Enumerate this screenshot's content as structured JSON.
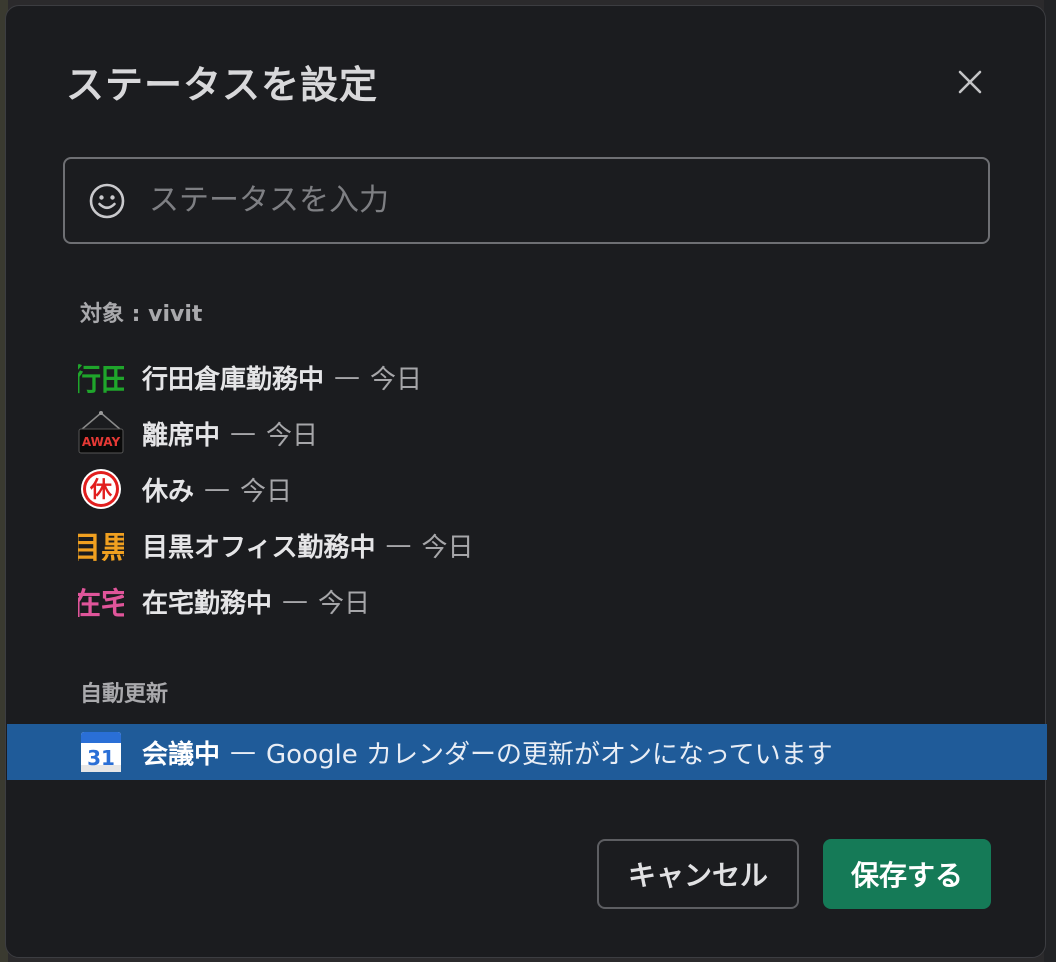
{
  "modal": {
    "title": "ステータスを設定",
    "close_icon": "close-icon"
  },
  "search": {
    "placeholder": "ステータスを入力",
    "value": "",
    "emoji_icon": "smiley-face-icon"
  },
  "recent": {
    "label": "対象 : vivit",
    "items": [
      {
        "icon": "gyoda-emoji-icon",
        "icon_text": "行田",
        "icon_color": "#1fa52b",
        "name": "行田倉庫勤務中",
        "separator": "—",
        "until": "今日"
      },
      {
        "icon": "away-sign-emoji-icon",
        "icon_text": "AWAY",
        "icon_color": "#e53935",
        "name": "離席中",
        "separator": "—",
        "until": "今日"
      },
      {
        "icon": "kyuu-rest-emoji-icon",
        "icon_text": "休",
        "icon_color": "#e21e1e",
        "name": "休み",
        "separator": "—",
        "until": "今日"
      },
      {
        "icon": "meguro-emoji-icon",
        "icon_text": "目黒",
        "icon_color": "#f0a020",
        "name": "目黒オフィス勤務中",
        "separator": "—",
        "until": "今日"
      },
      {
        "icon": "zaitaku-emoji-icon",
        "icon_text": "在宅",
        "icon_color": "#e0559a",
        "name": "在宅勤務中",
        "separator": "—",
        "until": "今日"
      }
    ]
  },
  "auto": {
    "label": "自動更新",
    "item": {
      "icon": "calendar-31-icon",
      "icon_text": "31",
      "name": "会議中",
      "separator": "—",
      "until": "Google カレンダーの更新がオンになっています",
      "highlight_color": "#1f5b99"
    }
  },
  "buttons": {
    "cancel": "キャンセル",
    "save": "保存する",
    "save_color": "#157a57"
  }
}
